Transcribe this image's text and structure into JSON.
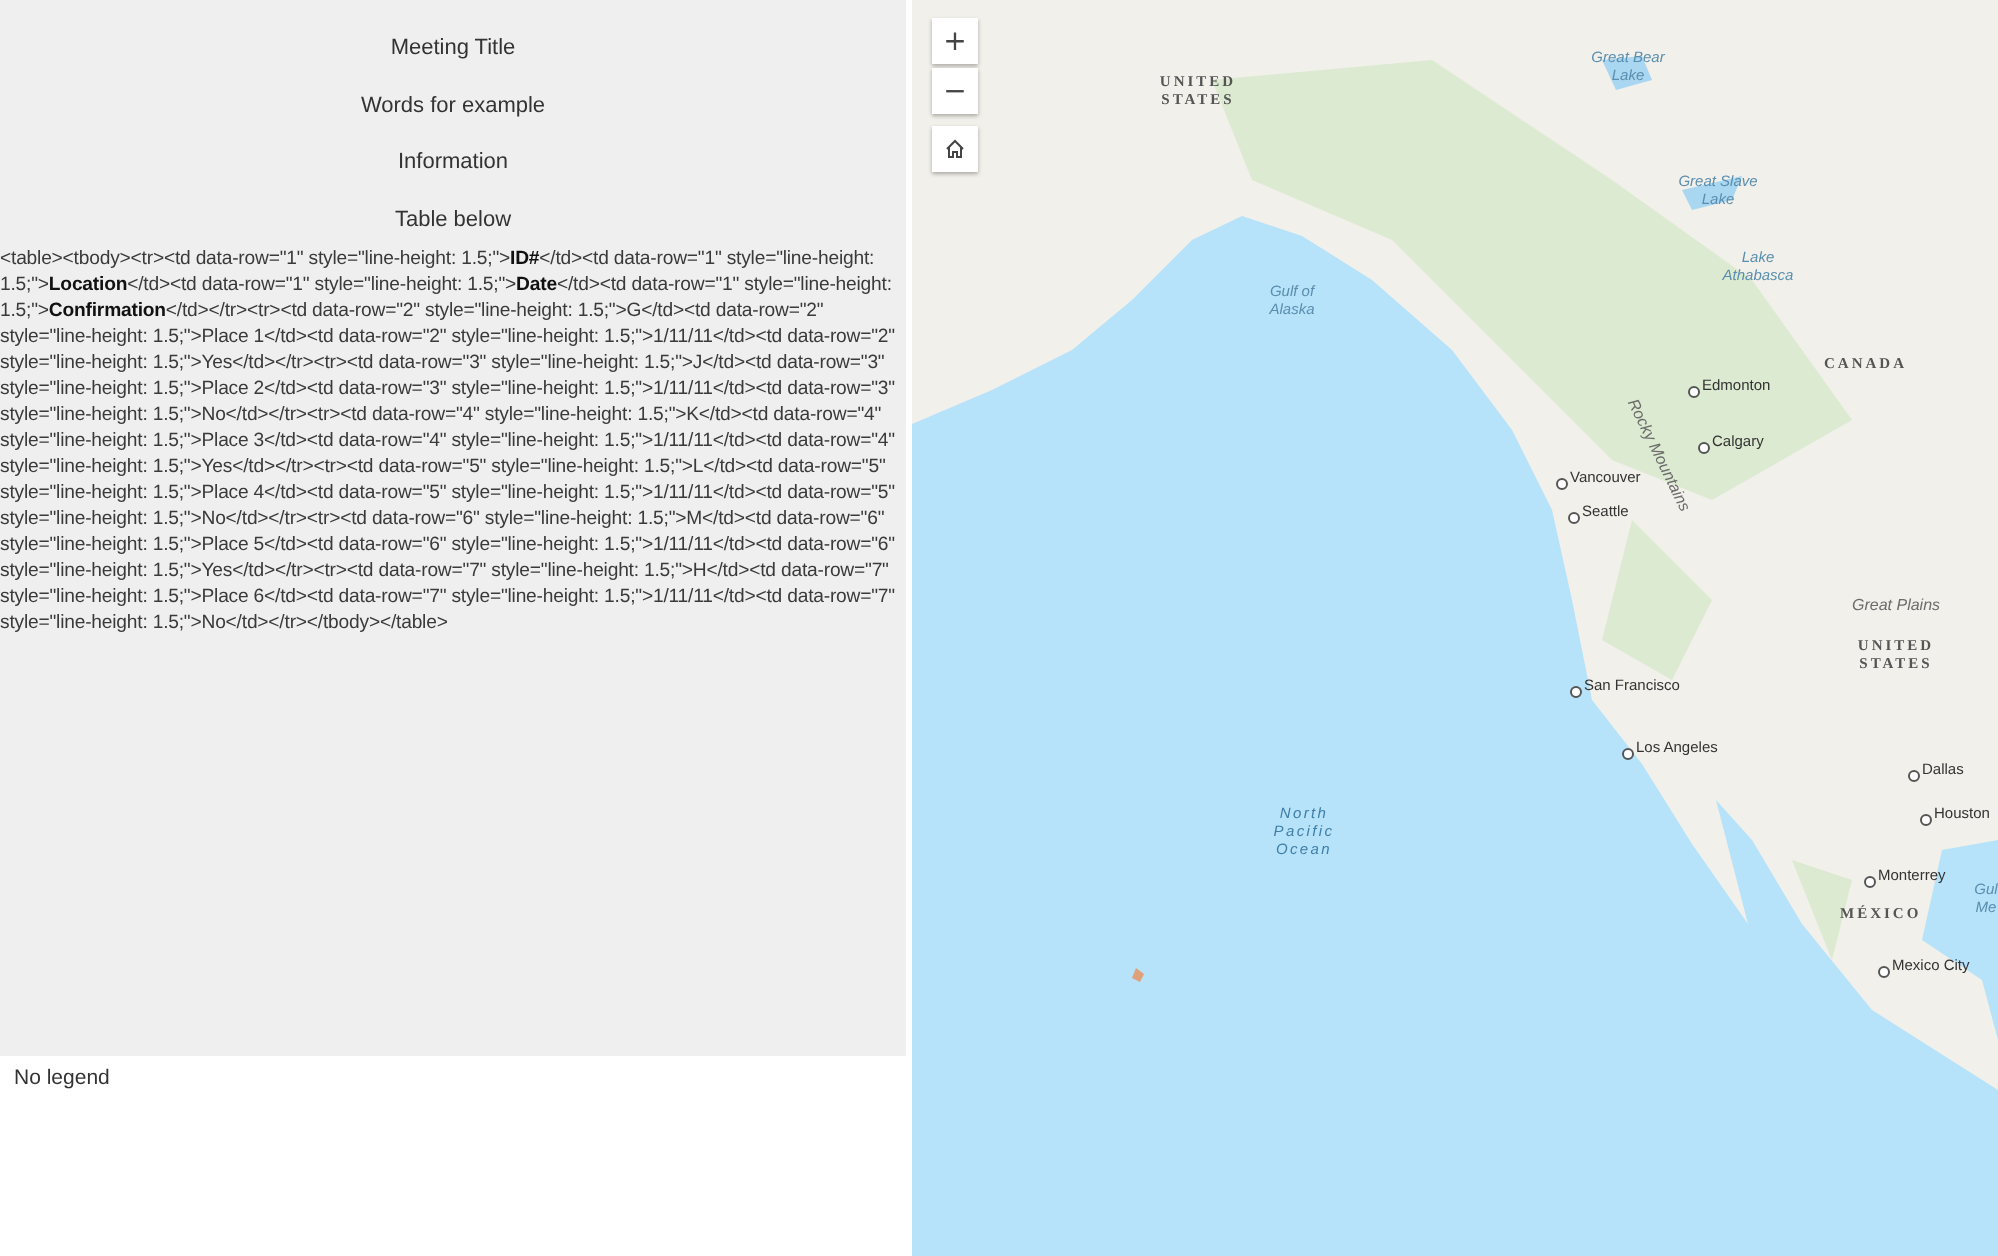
{
  "panel": {
    "headings": [
      "Meeting Title",
      "Words for example",
      "Information",
      "Table below"
    ],
    "body": "<table><tbody><tr><td data-row=\"1\" style=\"line-height: 1.5;\">**ID#**</td><td data-row=\"1\" style=\"line-height: 1.5;\">**Location**</td><td data-row=\"1\" style=\"line-height: 1.5;\">**Date**</td><td data-row=\"1\" style=\"line-height: 1.5;\">**Confirmation**</td></tr><tr><td data-row=\"2\" style=\"line-height: 1.5;\">G</td><td data-row=\"2\" style=\"line-height: 1.5;\">Place 1</td><td data-row=\"2\" style=\"line-height: 1.5;\">1/11/11</td><td data-row=\"2\" style=\"line-height: 1.5;\">Yes</td></tr><tr><td data-row=\"3\" style=\"line-height: 1.5;\">J</td><td data-row=\"3\" style=\"line-height: 1.5;\">Place 2</td><td data-row=\"3\" style=\"line-height: 1.5;\">1/11/11</td><td data-row=\"3\" style=\"line-height: 1.5;\">No</td></tr><tr><td data-row=\"4\" style=\"line-height: 1.5;\">K</td><td data-row=\"4\" style=\"line-height: 1.5;\">Place 3</td><td data-row=\"4\" style=\"line-height: 1.5;\">1/11/11</td><td data-row=\"4\" style=\"line-height: 1.5;\">Yes</td></tr><tr><td data-row=\"5\" style=\"line-height: 1.5;\">L</td><td data-row=\"5\" style=\"line-height: 1.5;\">Place 4</td><td data-row=\"5\" style=\"line-height: 1.5;\">1/11/11</td><td data-row=\"5\" style=\"line-height: 1.5;\">No</td></tr><tr><td data-row=\"6\" style=\"line-height: 1.5;\">M</td><td data-row=\"6\" style=\"line-height: 1.5;\">Place 5</td><td data-row=\"6\" style=\"line-height: 1.5;\">1/11/11</td><td data-row=\"6\" style=\"line-height: 1.5;\">Yes</td></tr><tr><td data-row=\"7\" style=\"line-height: 1.5;\">H</td><td data-row=\"7\" style=\"line-height: 1.5;\">Place 6</td><td data-row=\"7\" style=\"line-height: 1.5;\">1/11/11</td><td data-row=\"7\" style=\"line-height: 1.5;\">No</td></tr></tbody></table>"
  },
  "legend": {
    "text": "No legend"
  },
  "map": {
    "controls": [
      {
        "kind": "zoom-in",
        "label": "+"
      },
      {
        "kind": "zoom-out",
        "label": "−"
      },
      {
        "kind": "home"
      }
    ],
    "labels": [
      {
        "kind": "country",
        "text": "UNITED STATES"
      },
      {
        "kind": "water",
        "text": "Great Bear Lake"
      },
      {
        "kind": "water",
        "text": "Great Slave Lake"
      },
      {
        "kind": "water",
        "text": "Lake Athabasca"
      },
      {
        "kind": "water",
        "text": "Gulf of Alaska"
      },
      {
        "kind": "country",
        "text": "CANADA"
      },
      {
        "kind": "city",
        "text": "Edmonton"
      },
      {
        "kind": "city",
        "text": "Calgary"
      },
      {
        "kind": "region",
        "text": "Rocky Mountains"
      },
      {
        "kind": "city",
        "text": "Vancouver"
      },
      {
        "kind": "city",
        "text": "Seattle"
      },
      {
        "kind": "region",
        "text": "Great Plains"
      },
      {
        "kind": "country",
        "text": "UNITED STATES"
      },
      {
        "kind": "city",
        "text": "San Francisco"
      },
      {
        "kind": "city",
        "text": "Los Angeles"
      },
      {
        "kind": "city",
        "text": "Dallas"
      },
      {
        "kind": "city",
        "text": "Houston"
      },
      {
        "kind": "city",
        "text": "Monterrey"
      },
      {
        "kind": "country",
        "text": "MÉXICO"
      },
      {
        "kind": "city",
        "text": "Mexico City"
      },
      {
        "kind": "ocean",
        "text": "North Pacific Ocean"
      },
      {
        "kind": "water",
        "text": "Gul Me"
      }
    ]
  }
}
